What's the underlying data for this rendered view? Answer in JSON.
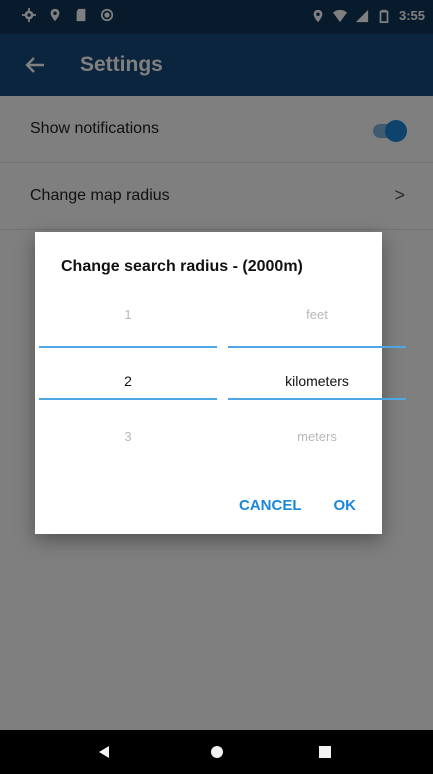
{
  "status_bar": {
    "time": "3:55",
    "left_icons": [
      "settings-icon",
      "location-pin-icon",
      "sd-card-icon",
      "circle-icon"
    ],
    "right_icons": [
      "location-pin-icon",
      "wifi-icon",
      "signal-icon",
      "battery-icon"
    ]
  },
  "app_bar": {
    "title": "Settings",
    "back_icon": "arrow-left-icon"
  },
  "settings": {
    "items": [
      {
        "label": "Show notifications",
        "control": "toggle",
        "toggle_on": true
      },
      {
        "label": "Change map radius",
        "control": "chevron",
        "chevron": ">"
      }
    ]
  },
  "dialog": {
    "title": "Change search radius - (2000m)",
    "number_picker": {
      "above": "1",
      "selected": "2",
      "below": "3"
    },
    "unit_picker": {
      "above": "feet",
      "selected": "kilometers",
      "below": "meters"
    },
    "cancel_label": "CANCEL",
    "ok_label": "OK"
  },
  "nav_bar": {
    "icons": [
      "nav-back-icon",
      "nav-home-icon",
      "nav-recents-icon"
    ]
  },
  "colors": {
    "status_bar": "#0e3658",
    "app_bar": "#144b7a",
    "accent": "#1a87d8",
    "picker_line": "#4ea7e4"
  }
}
